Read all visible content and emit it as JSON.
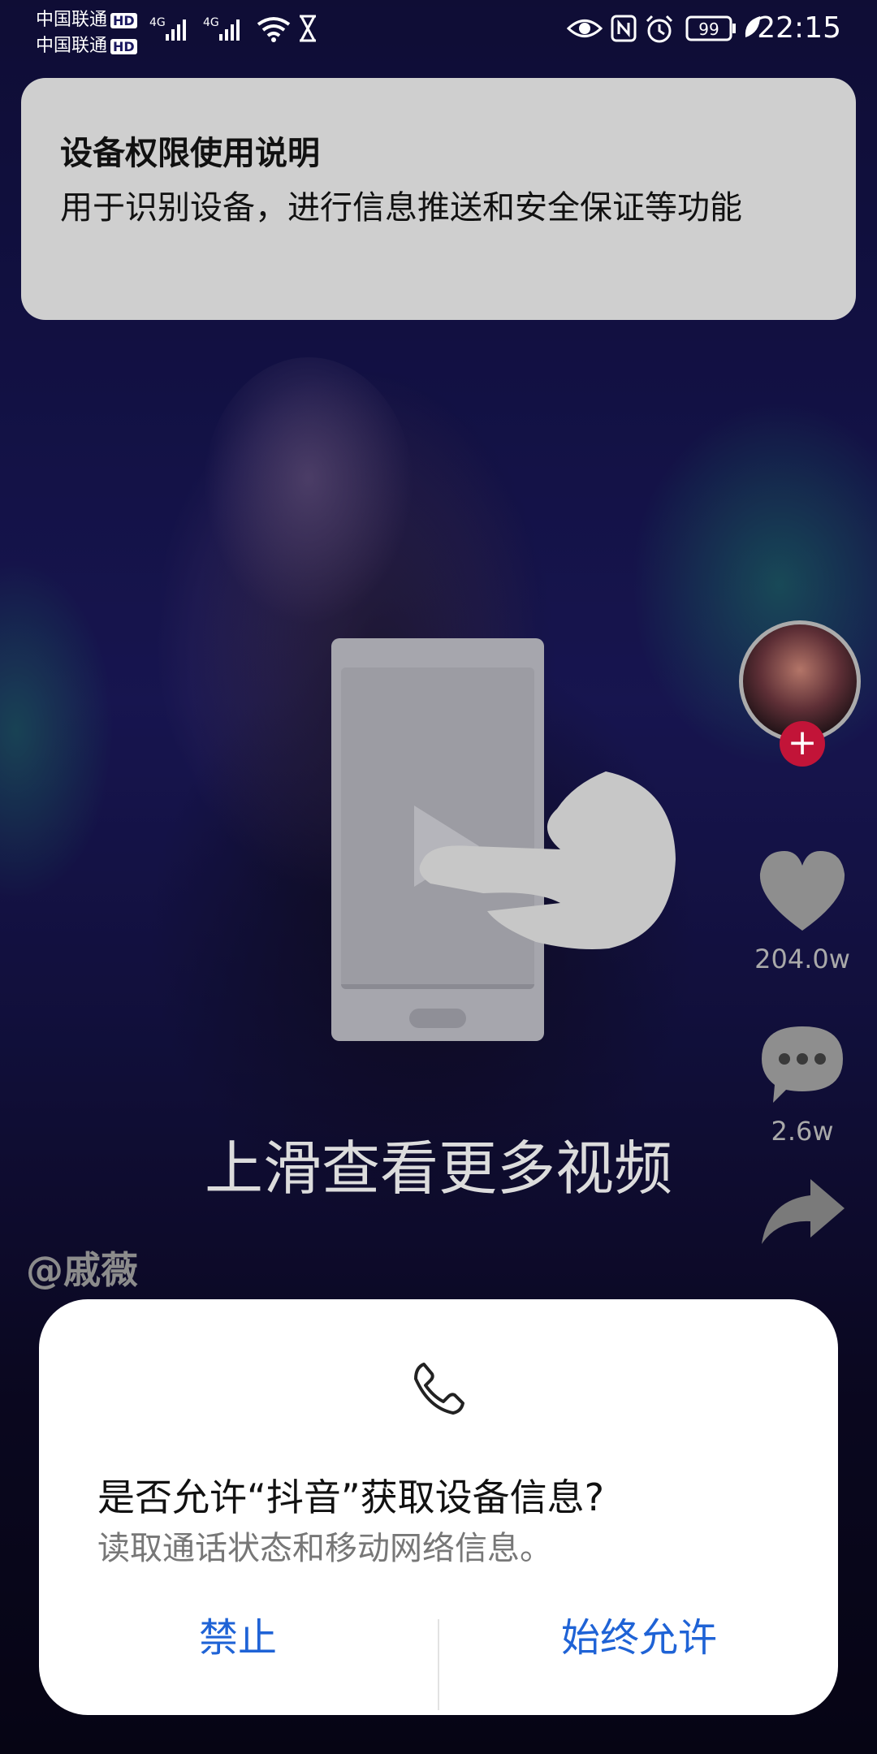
{
  "status_bar": {
    "carrier1": "中国联通",
    "carrier2": "中国联通",
    "hd_badge": "HD",
    "network": "4G",
    "battery": "99",
    "time": "22:15"
  },
  "permission_banner": {
    "title": "设备权限使用说明",
    "text": "用于识别设备，进行信息推送和安全保证等功能"
  },
  "guide": {
    "swipe_text": "上滑查看更多视频"
  },
  "video": {
    "author": "@戚薇",
    "like_count": "204.0w",
    "comment_count": "2.6w"
  },
  "dialog": {
    "title": "是否允许“抖音”获取设备信息?",
    "description": "读取通话状态和移动网络信息。",
    "deny_label": "禁止",
    "allow_label": "始终允许"
  },
  "colors": {
    "accent_blue": "#1f63d6",
    "follow_red": "#c21438"
  },
  "icons": [
    "phone-icon",
    "heart-icon",
    "comment-icon",
    "share-icon",
    "hand-icon",
    "play-icon",
    "wifi-icon",
    "eye-icon",
    "nfc-icon",
    "alarm-icon",
    "battery-icon"
  ]
}
